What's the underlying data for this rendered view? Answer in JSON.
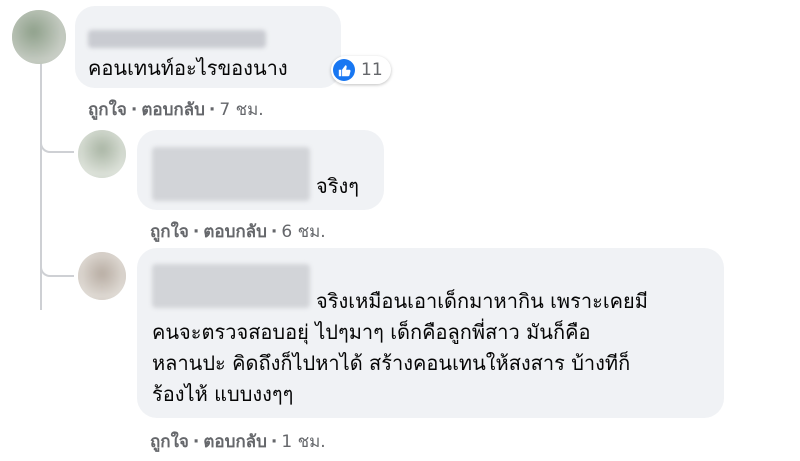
{
  "comments": [
    {
      "text_lines": [
        "คอนเทนท์อะไรของนาง"
      ],
      "reaction_count": "11",
      "actions": {
        "like": "ถูกใจ",
        "reply": "ตอบกลับ",
        "time": "7 ชม."
      }
    },
    {
      "text_lines": [
        "จริงๆ"
      ],
      "actions": {
        "like": "ถูกใจ",
        "reply": "ตอบกลับ",
        "time": "6 ชม."
      }
    },
    {
      "text_lines": [
        "จริงเหมือนเอาเด็กมาหากิน เพราะเคยมี",
        "คนจะตรวจสอบอยุ่ ไปๆมาๆ เด็กคือลูกพี่สาว มันก็คือ",
        "หลานปะ คิดถึงก็ไปหาได้ สร้างคอนเทนให้สงสาร บ้างทีก็",
        "ร้องไห้ แบบงงๆๆ"
      ],
      "actions": {
        "like": "ถูกใจ",
        "reply": "ตอบกลับ",
        "time": "1 ชม."
      }
    }
  ],
  "separator": "·",
  "colors": {
    "bubble": "#f0f2f5",
    "meta": "#65676b",
    "like_blue": "#1877f2"
  },
  "icons": {
    "reaction": "thumbs-up-icon"
  }
}
